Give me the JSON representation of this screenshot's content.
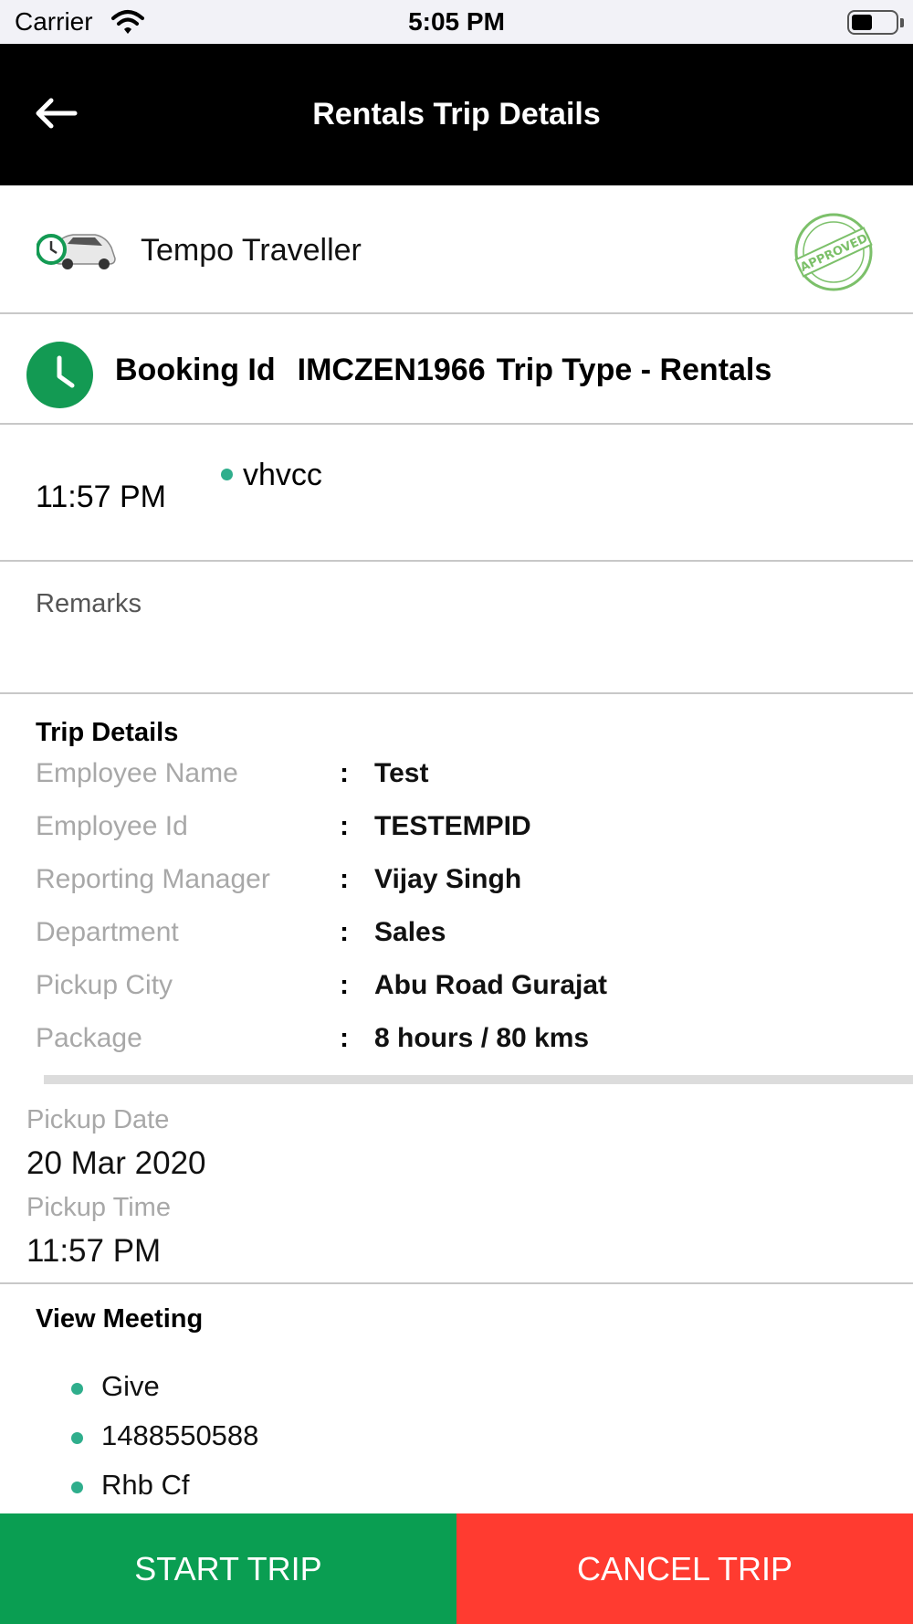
{
  "status_bar": {
    "carrier": "Carrier",
    "time": "5:05 PM"
  },
  "header": {
    "title": "Rentals Trip Details",
    "back_icon": "arrow-left-icon"
  },
  "vehicle": {
    "name": "Tempo Traveller",
    "icon": "car-with-clock-icon",
    "status_stamp": "APPROVED",
    "stamp_color": "#7cc06a"
  },
  "booking": {
    "label": "Booking Id",
    "id": "IMCZEN1966",
    "trip_type": "Trip Type - Rentals",
    "icon_color": "#139a53"
  },
  "trip_time": {
    "time": "11:57 PM",
    "location": "vhvcc"
  },
  "remarks": {
    "label": "Remarks"
  },
  "trip_details": {
    "heading": "Trip Details",
    "rows": [
      {
        "label": "Employee Name",
        "value": "Test"
      },
      {
        "label": "Employee Id",
        "value": "TESTEMPID"
      },
      {
        "label": "Reporting Manager",
        "value": "Vijay Singh"
      },
      {
        "label": "Department",
        "value": "Sales"
      },
      {
        "label": "Pickup City",
        "value": "Abu Road Gurajat"
      },
      {
        "label": "Package",
        "value": "8 hours / 80 kms"
      }
    ],
    "separator": ":"
  },
  "pickup": {
    "date_label": "Pickup Date",
    "date": "20 Mar 2020",
    "time_label": "Pickup Time",
    "time": "11:57 PM"
  },
  "meeting": {
    "heading": "View Meeting",
    "items": [
      "Give",
      "1488550588",
      "Rhb Cf"
    ]
  },
  "actions": {
    "start_label": "START TRIP",
    "cancel_label": "CANCEL TRIP",
    "start_color": "#0a9e52",
    "cancel_color": "#ff3b30"
  }
}
